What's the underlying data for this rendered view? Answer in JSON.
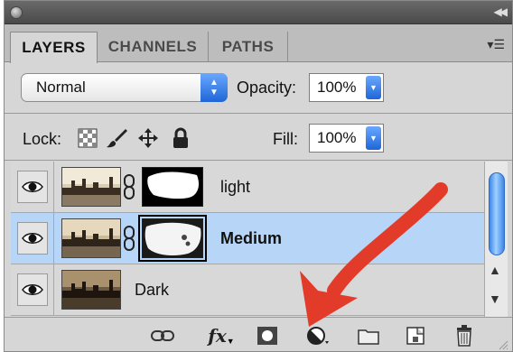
{
  "tabs": [
    {
      "label": "LAYERS",
      "active": true
    },
    {
      "label": "CHANNELS",
      "active": false
    },
    {
      "label": "PATHS",
      "active": false
    }
  ],
  "blend_mode": {
    "value": "Normal"
  },
  "opacity": {
    "label": "Opacity:",
    "value": "100%"
  },
  "lock": {
    "label": "Lock:",
    "icons": [
      "lock-transparent-pixels-icon",
      "lock-image-pixels-brush-icon",
      "lock-position-move-icon",
      "lock-all-padlock-icon"
    ]
  },
  "fill": {
    "label": "Fill:",
    "value": "100%"
  },
  "layers": [
    {
      "name": "light",
      "visible": true,
      "selected": false,
      "has_mask": true
    },
    {
      "name": "Medium",
      "visible": true,
      "selected": true,
      "has_mask": true
    },
    {
      "name": "Dark",
      "visible": true,
      "selected": false,
      "has_mask": false
    }
  ],
  "bottom_toolbar": {
    "icons": [
      "link-layers-icon",
      "layer-style-fx-icon",
      "add-mask-icon",
      "new-adjustment-layer-icon",
      "new-group-folder-icon",
      "new-layer-icon",
      "delete-layer-trash-icon"
    ],
    "fx_label": "fx"
  },
  "colors": {
    "accent_blue": "#1f66d6",
    "selection": "#b7d5f6",
    "annotation_red": "#e23b2a"
  }
}
